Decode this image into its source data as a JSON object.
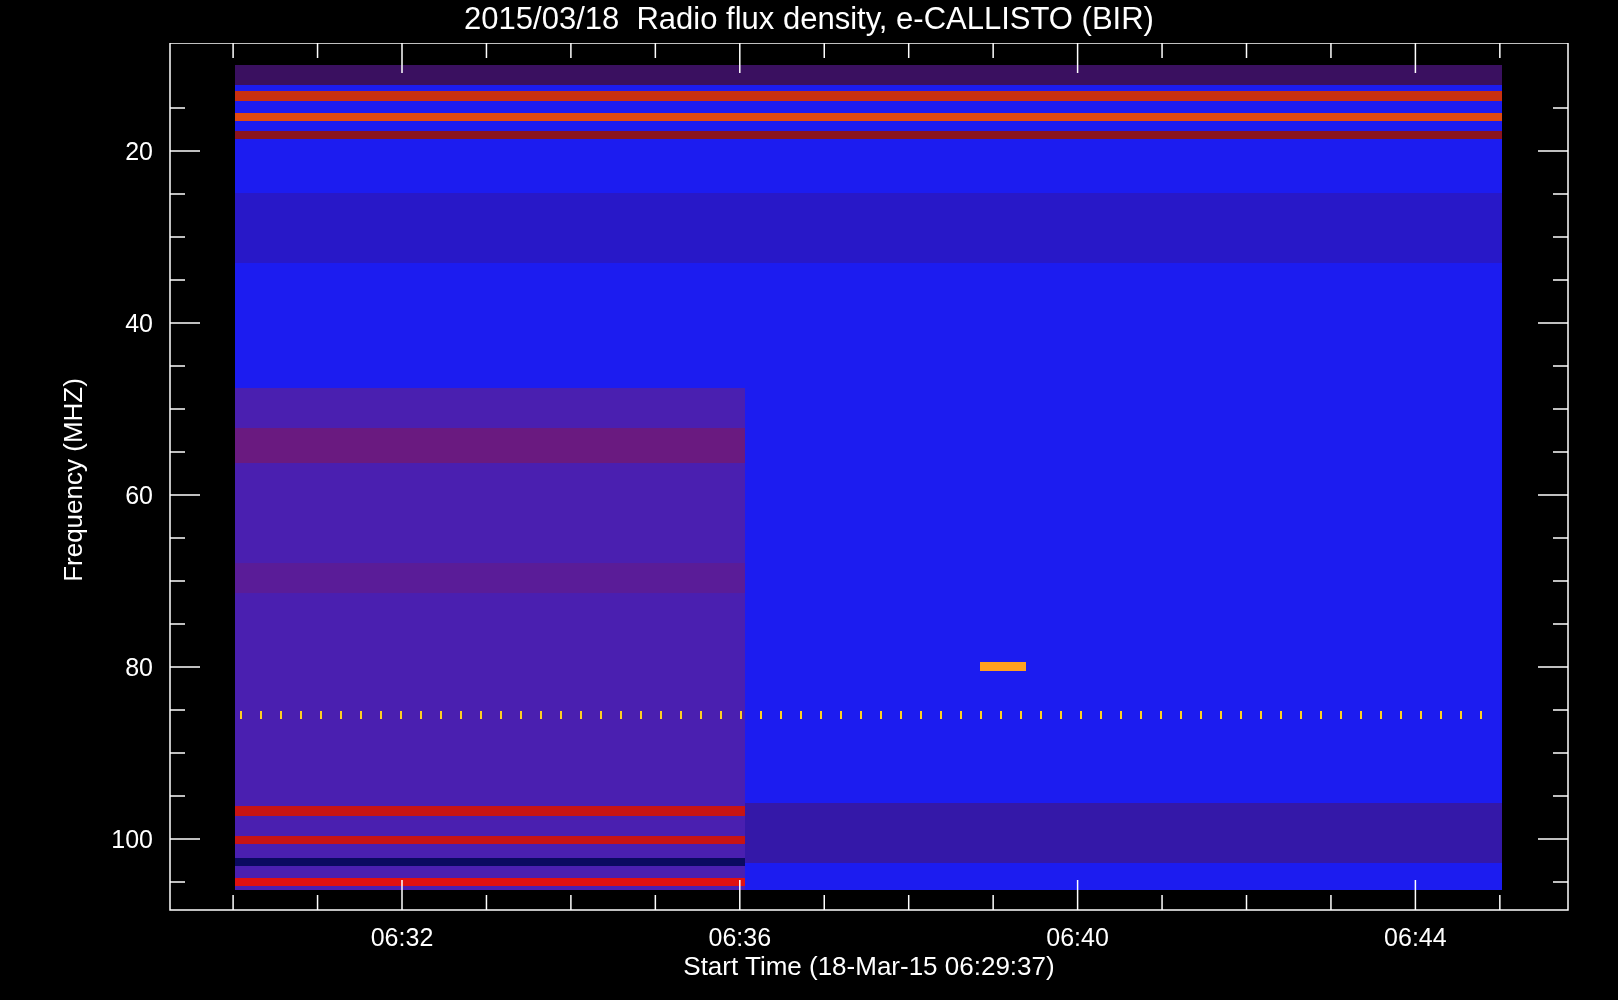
{
  "title": "2015/03/18  Radio flux density, e-CALLISTO (BIR)",
  "y_axis": {
    "label": "Frequency (MHZ)",
    "ticks": [
      "20",
      "40",
      "60",
      "80",
      "100"
    ]
  },
  "x_axis": {
    "label": "Start Time (18-Mar-15 06:29:37)",
    "ticks": [
      "06:32",
      "06:36",
      "06:40",
      "06:44"
    ]
  }
}
